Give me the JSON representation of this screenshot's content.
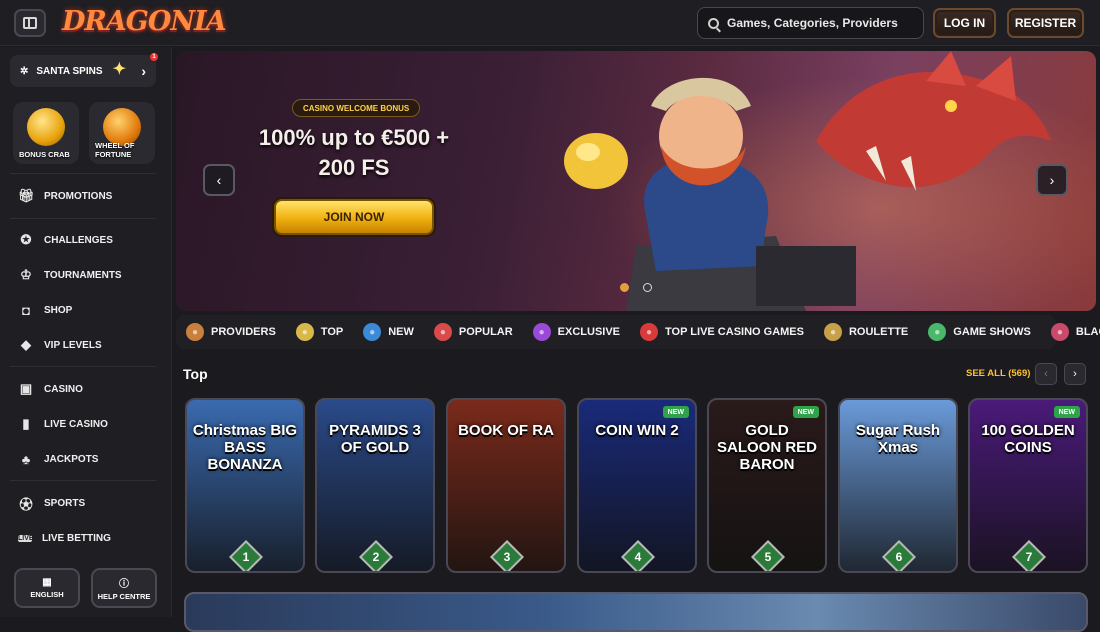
{
  "header": {
    "logo": "DRAGONIA",
    "search_placeholder": "Games, Categories, Providers",
    "login": "LOG IN",
    "register": "REGISTER"
  },
  "sidebar": {
    "santa_spins": "SANTA SPINS",
    "santa_badge": "1",
    "tiles": [
      {
        "label": "BONUS CRAB"
      },
      {
        "label": "WHEEL OF FORTUNE"
      }
    ],
    "items": [
      {
        "label": "PROMOTIONS",
        "icon": "gift-icon"
      },
      {
        "label": "CHALLENGES",
        "icon": "medal-icon"
      },
      {
        "label": "TOURNAMENTS",
        "icon": "trophy-icon"
      },
      {
        "label": "SHOP",
        "icon": "shop-bag-icon"
      },
      {
        "label": "VIP LEVELS",
        "icon": "diamond-icon"
      },
      {
        "label": "CASINO",
        "icon": "slot-machine-icon"
      },
      {
        "label": "LIVE CASINO",
        "icon": "card-icon"
      },
      {
        "label": "JACKPOTS",
        "icon": "clover-icon"
      },
      {
        "label": "SPORTS",
        "icon": "soccer-ball-icon"
      },
      {
        "label": "LIVE BETTING",
        "icon": "live-icon"
      }
    ],
    "language": "ENGLISH",
    "help": "HELP CENTRE"
  },
  "banner": {
    "tag": "CASINO WELCOME BONUS",
    "title_line1": "100% up to €500 +",
    "title_line2": "200 FS",
    "cta": "JOIN NOW",
    "slide_count": 2,
    "active_slide": 1
  },
  "categories": [
    {
      "label": "PROVIDERS",
      "color": "#c9803a"
    },
    {
      "label": "TOP",
      "color": "#d9b84a"
    },
    {
      "label": "NEW",
      "color": "#3a8ad9"
    },
    {
      "label": "POPULAR",
      "color": "#d94a4a"
    },
    {
      "label": "EXCLUSIVE",
      "color": "#9a4ad9"
    },
    {
      "label": "TOP LIVE CASINO GAMES",
      "color": "#d93a3a"
    },
    {
      "label": "ROULETTE",
      "color": "#c9a04a"
    },
    {
      "label": "GAME SHOWS",
      "color": "#4ab86a"
    },
    {
      "label": "BLACKJACK",
      "color": "#c94a6a"
    }
  ],
  "section": {
    "title": "Top",
    "see_all": "SEE ALL (569)"
  },
  "games": [
    {
      "name": "Christmas BIG BASS BONANZA",
      "rank": "1",
      "new": false,
      "bg": "#3a6ab0"
    },
    {
      "name": "PYRAMIDS 3 OF GOLD",
      "rank": "2",
      "new": false,
      "bg": "#2a4a8a"
    },
    {
      "name": "BOOK OF RA",
      "rank": "3",
      "new": false,
      "bg": "#7a2a1a"
    },
    {
      "name": "COIN WIN 2",
      "rank": "4",
      "new": true,
      "bg": "#1a2a7a"
    },
    {
      "name": "GOLD SALOON RED BARON",
      "rank": "5",
      "new": true,
      "bg": "#2a1a1a"
    },
    {
      "name": "Sugar Rush Xmas",
      "rank": "6",
      "new": false,
      "bg": "#6a9ad9"
    },
    {
      "name": "100 GOLDEN COINS",
      "rank": "7",
      "new": true,
      "bg": "#4a1a7a"
    }
  ],
  "new_badge": "NEW"
}
